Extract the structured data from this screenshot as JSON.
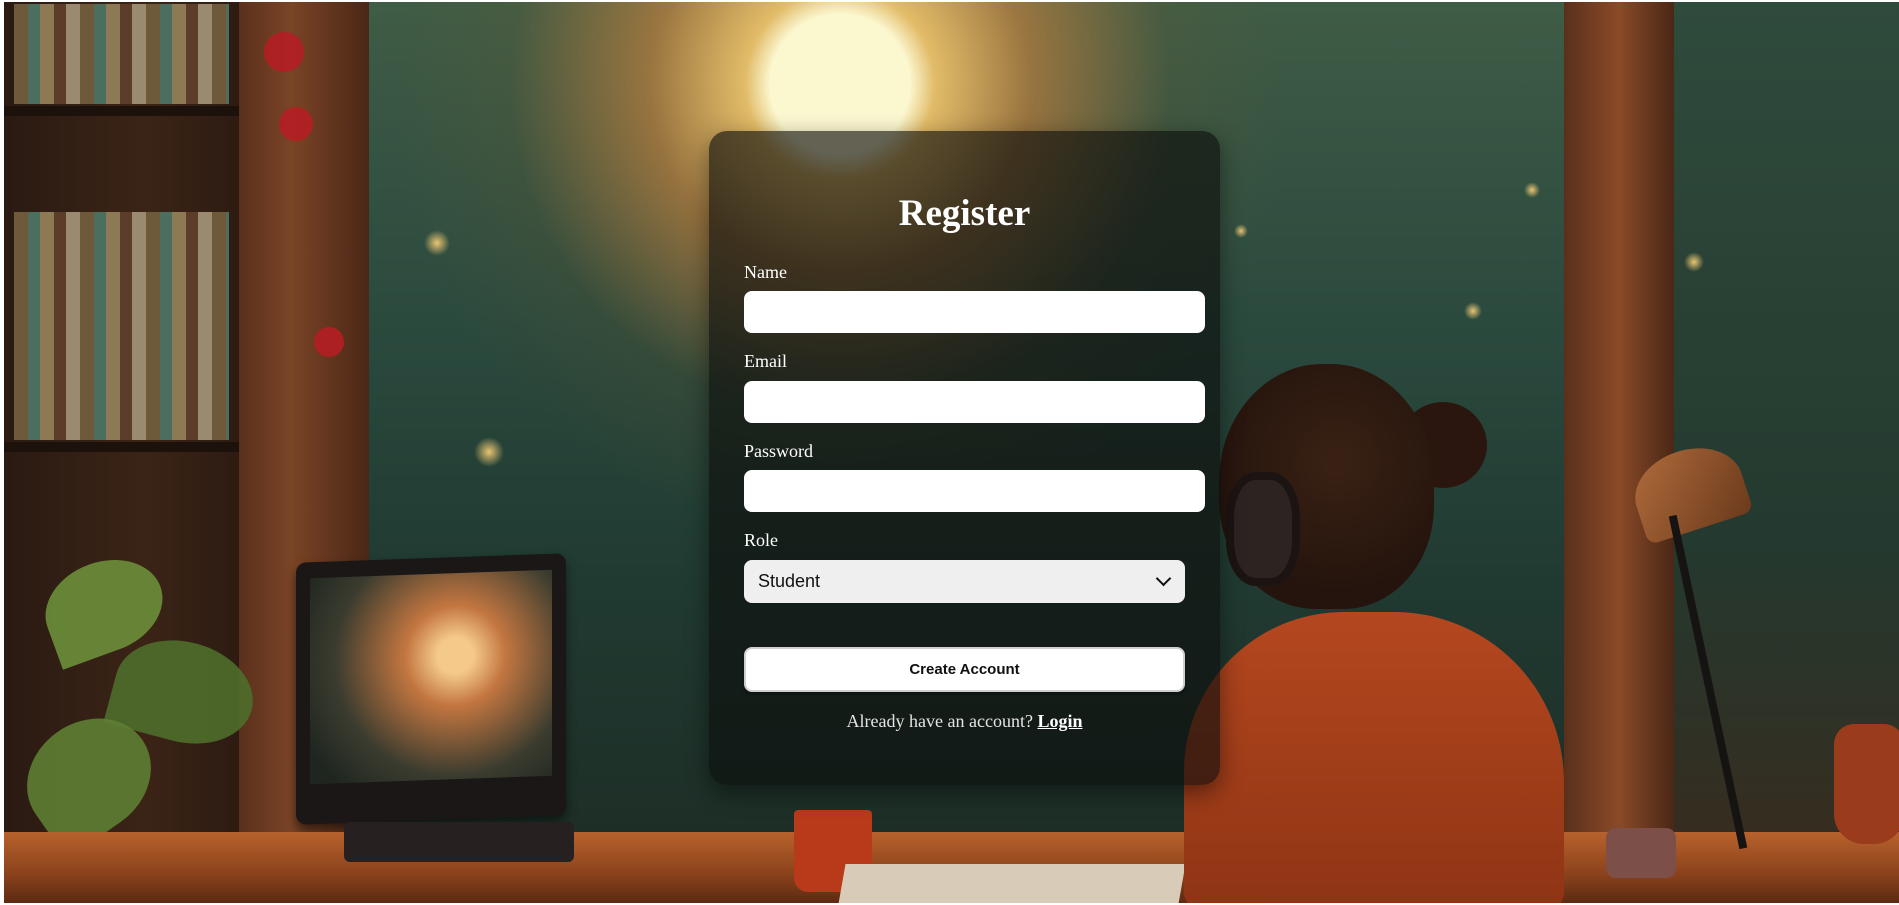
{
  "form": {
    "title": "Register",
    "fields": {
      "name": {
        "label": "Name",
        "value": ""
      },
      "email": {
        "label": "Email",
        "value": ""
      },
      "password": {
        "label": "Password",
        "value": ""
      },
      "role": {
        "label": "Role",
        "selected": "Student"
      }
    },
    "submit_label": "Create Account",
    "footer_text": "Already have an account?",
    "login_link": "Login"
  },
  "colors": {
    "card_background": "#0c0e0d",
    "text": "#ffffff",
    "input_background": "#ffffff",
    "select_background": "#efefef"
  }
}
